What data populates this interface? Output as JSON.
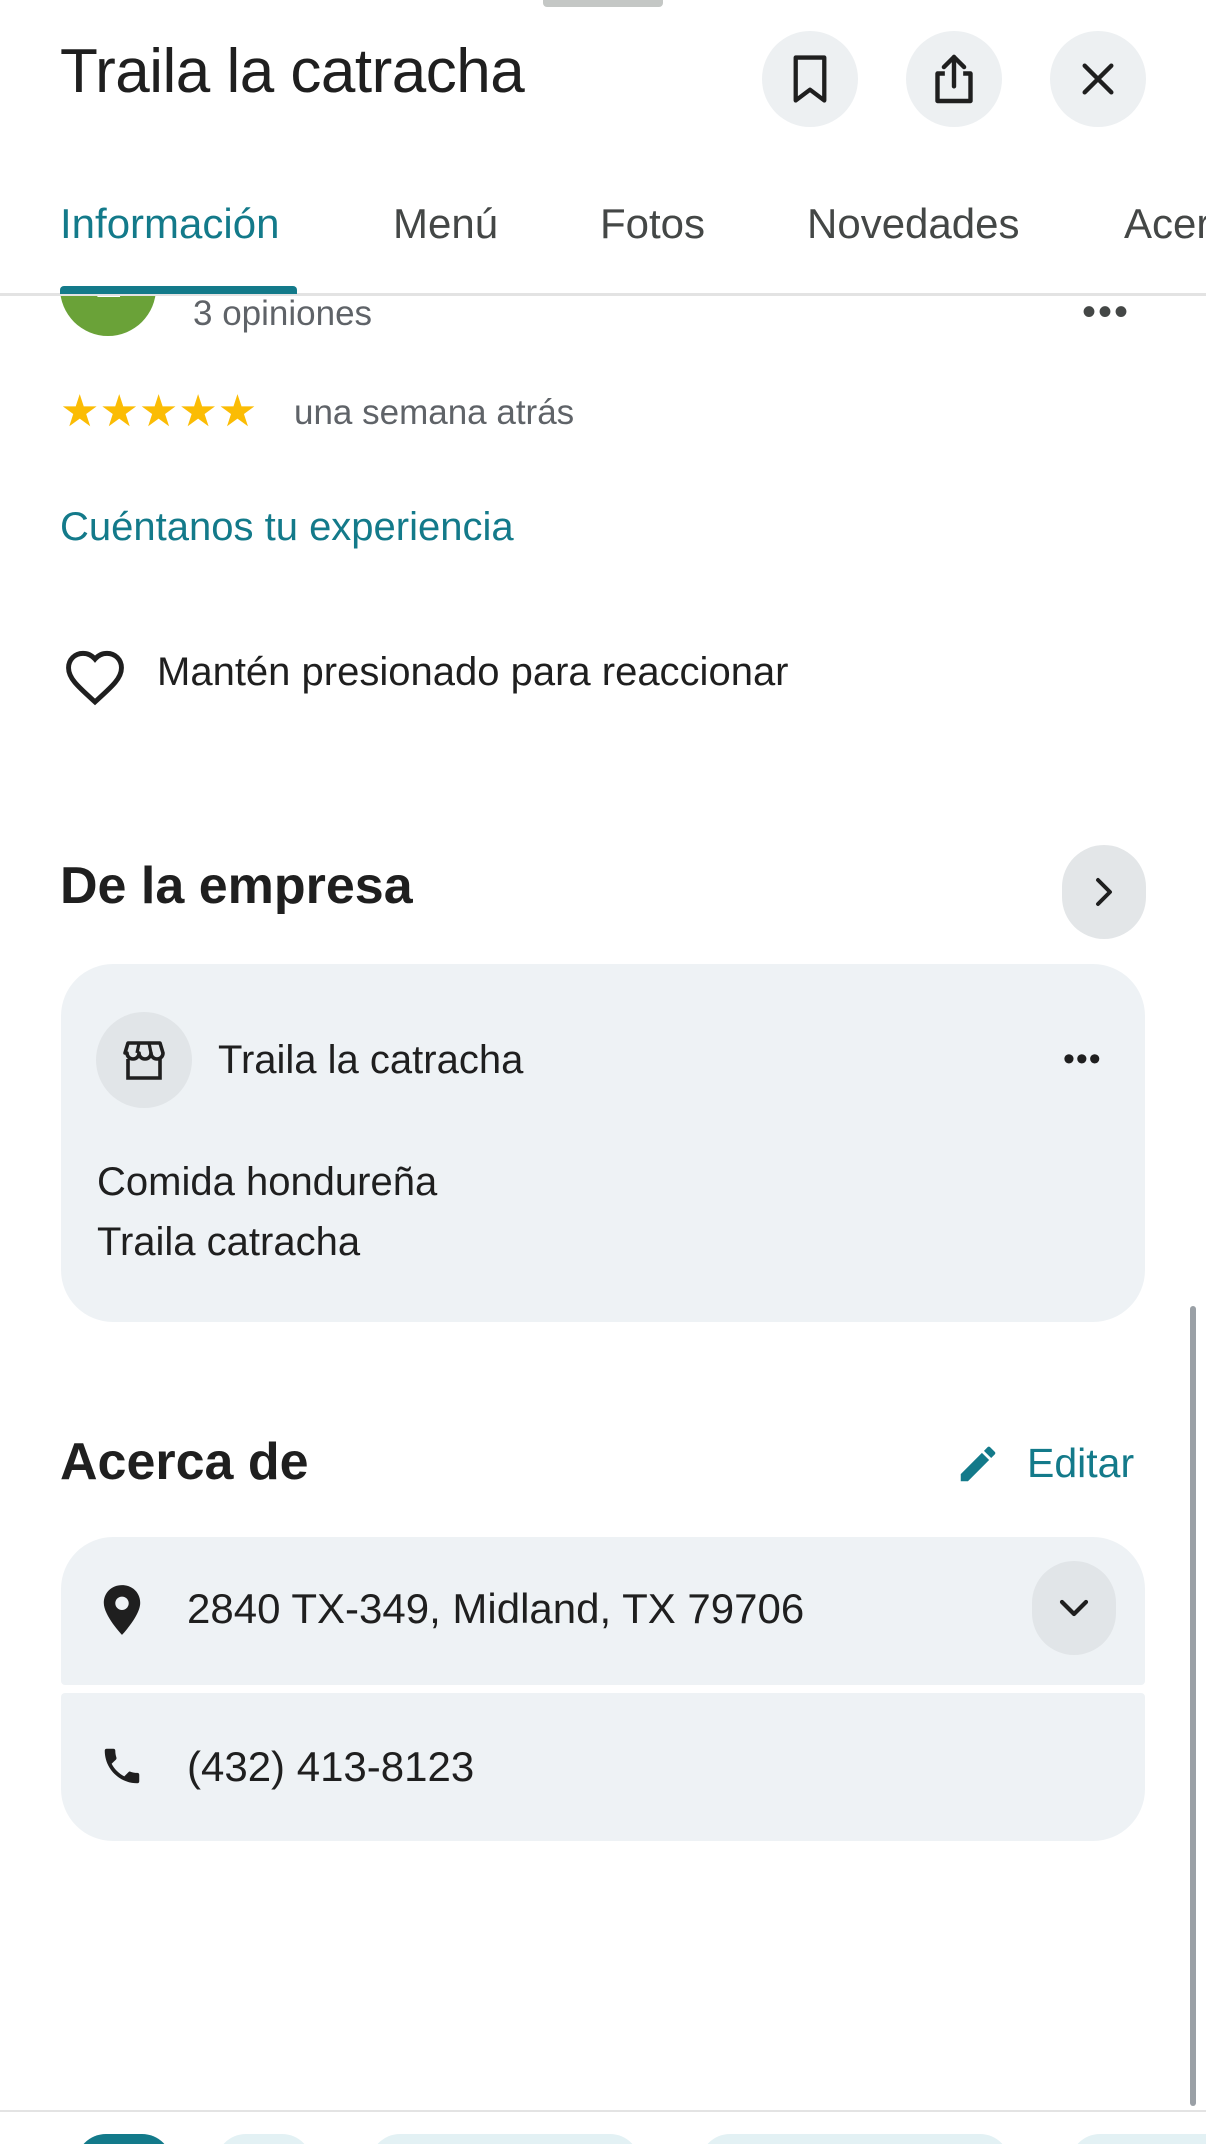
{
  "header": {
    "title": "Traila la catracha",
    "save_icon": "bookmark-icon",
    "share_icon": "share-icon",
    "close_icon": "close-icon"
  },
  "tabs": [
    {
      "label": "Información",
      "active": true
    },
    {
      "label": "Menú"
    },
    {
      "label": "Fotos"
    },
    {
      "label": "Novedades"
    },
    {
      "label": "Acer"
    }
  ],
  "review": {
    "avatar_letter": "L",
    "reviews_count": "3 opiniones",
    "rating": 5,
    "stars": "★★★★★",
    "time": "una semana atrás",
    "cta": "Cuéntanos tu experiencia",
    "reaction_hint": "Mantén presionado para reaccionar"
  },
  "business": {
    "section_title": "De la empresa",
    "name": "Traila la catracha",
    "line1": "Comida hondureña",
    "line2": "Traila catracha"
  },
  "about": {
    "section_title": "Acerca de",
    "edit_label": "Editar",
    "address": "2840 TX-349, Midland, TX 79706",
    "phone": "(432) 413-8123"
  },
  "colors": {
    "accent": "#137a8a",
    "star": "#fbbc04",
    "card_bg": "#eef2f5",
    "avatar": "#6aa238"
  }
}
